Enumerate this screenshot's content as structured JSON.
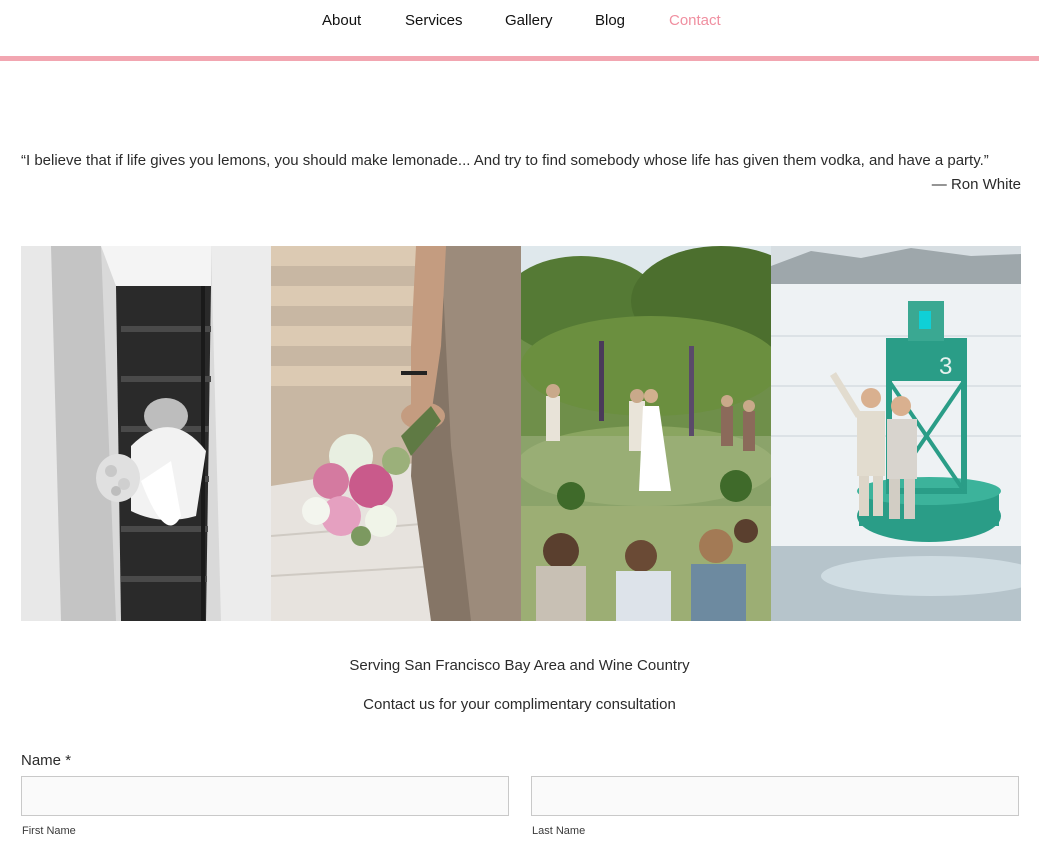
{
  "nav": {
    "items": [
      {
        "label": "About",
        "active": false
      },
      {
        "label": "Services",
        "active": false
      },
      {
        "label": "Gallery",
        "active": false
      },
      {
        "label": "Blog",
        "active": false
      },
      {
        "label": "Contact",
        "active": true
      }
    ],
    "accent_color": "#f2a6b1",
    "active_color": "#f08fa0"
  },
  "quote": {
    "text": "“I believe that if life gives you lemons, you should make lemonade... And try to find somebody whose life has given them vodka, and have a party.”",
    "author": "— Ron White"
  },
  "gallery": {
    "photos": [
      {
        "icon": "bride-on-staircase-photo"
      },
      {
        "icon": "bridal-bouquet-photo"
      },
      {
        "icon": "garden-ceremony-photo"
      },
      {
        "icon": "grooms-on-buoy-photo"
      }
    ]
  },
  "info": {
    "serving": "Serving San Francisco Bay Area and Wine Country",
    "consultation": "Contact us for your complimentary consultation"
  },
  "form": {
    "name_label": "Name",
    "required_mark": "*",
    "first_name_value": "",
    "last_name_value": "",
    "first_name_sub": "First Name",
    "last_name_sub": "Last Name"
  }
}
